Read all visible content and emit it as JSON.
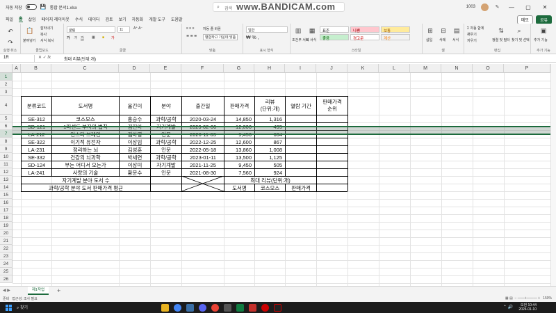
{
  "titlebar": {
    "autosave": "자동 저장",
    "file_name": "통합 문서1.xlsx",
    "search_placeholder": "검색",
    "watermark": "www.BANDICAM.com",
    "user": "1003",
    "minimize": "—",
    "restore": "▢",
    "close": "✕"
  },
  "tabs": [
    "파일",
    "홈",
    "삽입",
    "페이지 레이아웃",
    "수식",
    "데이터",
    "검토",
    "보기",
    "자동화",
    "개발 도구",
    "도움말"
  ],
  "tabs_active": "홈",
  "tab_memo": "메모",
  "tab_share": "공유",
  "ribbon": {
    "groups": [
      "실행 취소",
      "클립보드",
      "글꼴",
      "맞춤",
      "표시 형식",
      "스타일",
      "셀",
      "편집",
      "추가 기능"
    ],
    "paste": "붙여넣기",
    "cut": "잘라내기",
    "copy": "복사",
    "format_painter": "서식 복사",
    "font_name": "굴림",
    "font_size": "11",
    "wrap_text": "자동 줄 바꿈",
    "merge_center": "병합하고 가운데 맞춤",
    "number_format": "일반",
    "cond_format": "조건부 서식",
    "table_format": "표 서식",
    "styles": {
      "normal": "표준",
      "bad": "나쁨",
      "neutral": "보통",
      "good": "좋음",
      "warning": "경고문",
      "calc": "계산"
    },
    "insert": "삽입",
    "delete": "삭제",
    "format": "서식",
    "autosum": "자동 합계",
    "fill": "채우기",
    "clear": "지우기",
    "sort_filter": "정렬 및 필터",
    "find_select": "찾기 및 선택",
    "addins": "추가 기능"
  },
  "formula_bar": {
    "name_box": "1R",
    "fx": "fx",
    "content": "최대 리뷰(단위:개)"
  },
  "columns": [
    "A",
    "B",
    "C",
    "D",
    "E",
    "F",
    "G",
    "H",
    "I",
    "J",
    "K",
    "L",
    "M",
    "N",
    "O",
    "P"
  ],
  "rows": [
    "1",
    "2",
    "3",
    "4",
    "5",
    "6",
    "7",
    "8",
    "9",
    "10",
    "11",
    "12",
    "13",
    "14",
    "15",
    "16",
    "17",
    "18",
    "19",
    "20",
    "21",
    "22",
    "23",
    "24",
    "25",
    "26"
  ],
  "table": {
    "headers": [
      "분류코드",
      "도서명",
      "옮긴이",
      "분야",
      "출간일",
      "판매가격",
      "리뷰\n(단위:개)",
      "열람 기간",
      "판매가격\n순위"
    ],
    "rows": [
      [
        "SE-312",
        "코스모스",
        "홍승수",
        "과학/공학",
        "2020-03-24",
        "14,850",
        "1,316",
        "",
        ""
      ],
      [
        "SD-121",
        "1퍼센트 부자의 법칙",
        "김진아",
        "자기계발",
        "2023-02-06",
        "12,000",
        "495",
        "",
        ""
      ],
      [
        "LA-212",
        "인스타 브레인",
        "김아영",
        "인문",
        "2020-11-03",
        "9,450",
        "604",
        "",
        ""
      ],
      [
        "SE-322",
        "이기적 유전자",
        "이상임",
        "과학/공학",
        "2022-12-25",
        "12,600",
        "867",
        "",
        ""
      ],
      [
        "LA-231",
        "정리하는 뇌",
        "김성훈",
        "인문",
        "2022-05-18",
        "13,860",
        "1,008",
        "",
        ""
      ],
      [
        "SE-332",
        "건강의 뇌과학",
        "박세연",
        "과학/공학",
        "2023-01-11",
        "13,500",
        "1,125",
        "",
        ""
      ],
      [
        "SD-124",
        "부는 어디서 오는가",
        "이상미",
        "자기계발",
        "2021-11-25",
        "9,450",
        "505",
        "",
        ""
      ],
      [
        "LA-241",
        "사랑의 기술",
        "황문수",
        "인문",
        "2021-08-30",
        "7,560",
        "924",
        "",
        ""
      ]
    ],
    "summary1_label": "자기계발 분야 도서 수",
    "summary2_label": "과학/공학 분야 도서 판매가격 평균",
    "max_review_label": "최대 리뷰(단위:개)",
    "book_label": "도서명",
    "book_value": "코스모스",
    "price_label": "판매가격"
  },
  "sheet": {
    "tab_name": "제1작업",
    "add": "+"
  },
  "status": {
    "ready": "준비",
    "accessibility": "접근성: 조사 필요",
    "zoom": "150%"
  },
  "taskbar": {
    "search": "찾기",
    "time": "오전 10:44",
    "date": "2024-01-10"
  },
  "colors": {
    "excel_green": "#1d6b3d",
    "selection": "#8fa39a",
    "good_fill": "#c6efce",
    "bad_fill": "#ffc7ce",
    "neutral_fill": "#ffeb9c"
  }
}
